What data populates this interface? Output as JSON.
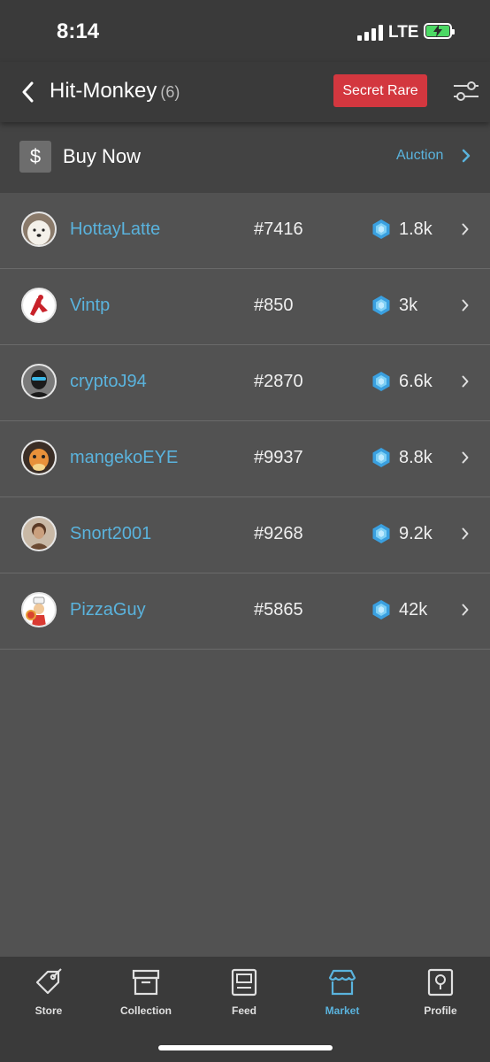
{
  "status_bar": {
    "time": "8:14",
    "network": "LTE",
    "battery_color": "#4cd964"
  },
  "header": {
    "title": "Hit-Monkey",
    "count": "(6)",
    "rarity_badge": "Secret Rare",
    "filter_icon": "sliders-icon",
    "back_icon": "chevron-left-icon"
  },
  "buy_bar": {
    "icon_glyph": "$",
    "label": "Buy Now",
    "alt_mode": "Auction"
  },
  "listings": [
    {
      "seller": "HottayLatte",
      "serial": "#7416",
      "price": "1.8k"
    },
    {
      "seller": "Vintp",
      "serial": "#850",
      "price": "3k"
    },
    {
      "seller": "cryptoJ94",
      "serial": "#2870",
      "price": "6.6k"
    },
    {
      "seller": "mangekoEYE",
      "serial": "#9937",
      "price": "8.8k"
    },
    {
      "seller": "Snort2001",
      "serial": "#9268",
      "price": "9.2k"
    },
    {
      "seller": "PizzaGuy",
      "serial": "#5865",
      "price": "42k"
    }
  ],
  "tabs": [
    {
      "label": "Store",
      "icon": "tag-icon"
    },
    {
      "label": "Collection",
      "icon": "archive-box-icon"
    },
    {
      "label": "Feed",
      "icon": "feed-icon"
    },
    {
      "label": "Market",
      "icon": "storefront-icon",
      "active": true
    },
    {
      "label": "Profile",
      "icon": "profile-pin-icon"
    }
  ],
  "colors": {
    "accent": "#5ab3dd",
    "rarity": "#d3373f",
    "background": "#525252",
    "bars": "#3a3a3a"
  }
}
